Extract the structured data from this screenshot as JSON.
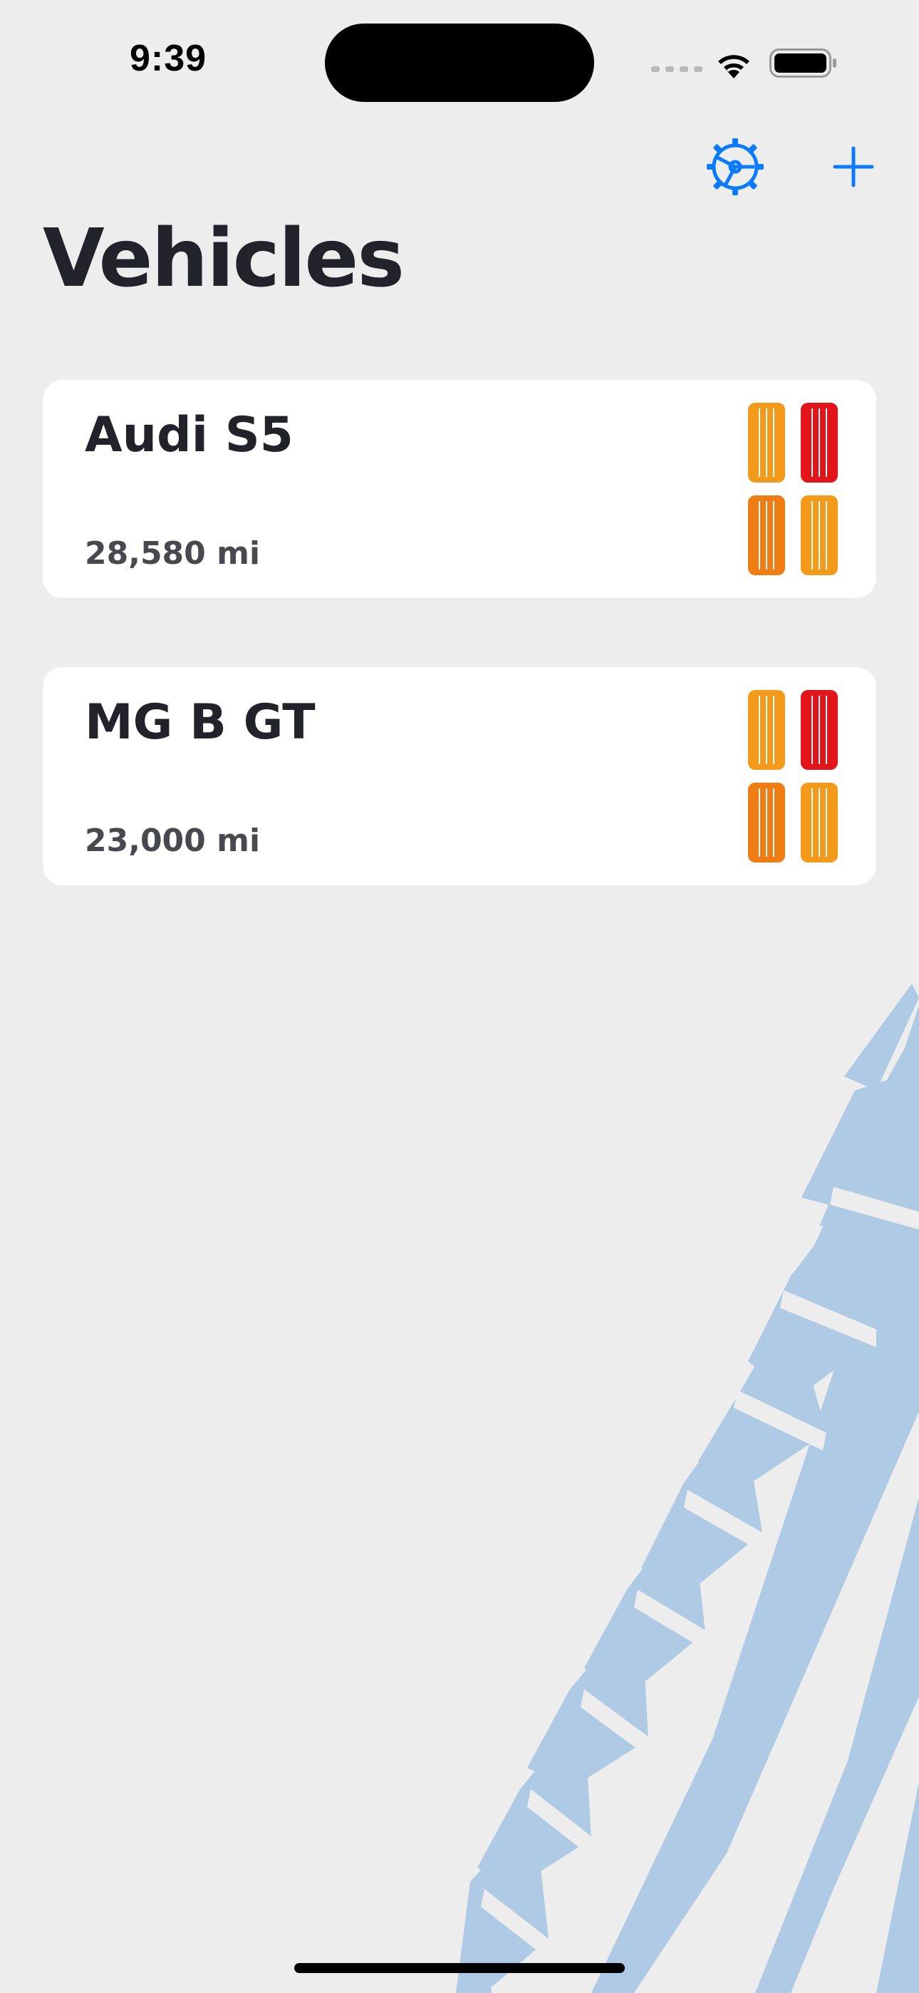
{
  "status_bar": {
    "time": "9:39",
    "icons": [
      "signal-dots-icon",
      "wifi-icon",
      "battery-icon"
    ]
  },
  "nav": {
    "settings_icon": "steering-wheel-gear-icon",
    "add_icon": "plus-icon"
  },
  "page": {
    "title": "Vehicles"
  },
  "vehicles": [
    {
      "name": "Audi S5",
      "mileage": "28,580 mi",
      "tires": [
        "orange",
        "red",
        "orange",
        "orange"
      ]
    },
    {
      "name": "MG B GT",
      "mileage": "23,000 mi",
      "tires": [
        "orange",
        "red",
        "orange",
        "orange"
      ]
    }
  ],
  "colors": {
    "accent": "#0a7aff",
    "background": "#ededed",
    "card": "#ffffff",
    "title": "#22222a",
    "tire_orange": "#f39a1a",
    "tire_orange_dark": "#ef7d14",
    "tire_red": "#e4141b",
    "background_tire": "#aecae4"
  }
}
